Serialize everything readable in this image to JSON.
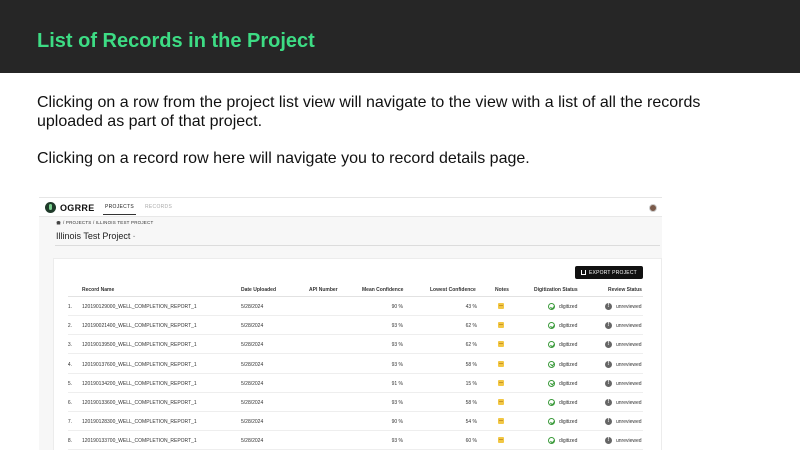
{
  "slide": {
    "title": "List of Records in the Project",
    "paragraph1": "Clicking on a row from the project list view will navigate to the view with a list of all the records uploaded as part of that project.",
    "paragraph2": "Clicking on a record row here will navigate you to record details page."
  },
  "app": {
    "brand": "OGRRE",
    "nav": {
      "projects": "PROJECTS",
      "records": "RECORDS"
    },
    "breadcrumb": "/ PROJECTS / ILLINOIS TEST PROJECT",
    "project_title": "Illinois Test Project",
    "export_label": "EXPORT PROJECT",
    "columns": {
      "record_name": "Record Name",
      "date_uploaded": "Date Uploaded",
      "api_number": "API Number",
      "mean_confidence": "Mean Confidence",
      "lowest_confidence": "Lowest Confidence",
      "notes": "Notes",
      "digitization_status": "Digitization Status",
      "review_status": "Review Status"
    },
    "rows": [
      {
        "idx": "1.",
        "name": "120190129000_WELL_COMPLETION_REPORT_1",
        "date": "5/28/2024",
        "api": "",
        "mean": "90 %",
        "low": "43 %",
        "dig": "digitized",
        "rev": "unreviewed"
      },
      {
        "idx": "2.",
        "name": "120190021400_WELL_COMPLETION_REPORT_1",
        "date": "5/28/2024",
        "api": "",
        "mean": "93 %",
        "low": "62 %",
        "dig": "digitized",
        "rev": "unreviewed"
      },
      {
        "idx": "3.",
        "name": "120190139500_WELL_COMPLETION_REPORT_1",
        "date": "5/28/2024",
        "api": "",
        "mean": "93 %",
        "low": "62 %",
        "dig": "digitized",
        "rev": "unreviewed"
      },
      {
        "idx": "4.",
        "name": "120190137600_WELL_COMPLETION_REPORT_1",
        "date": "5/28/2024",
        "api": "",
        "mean": "93 %",
        "low": "58 %",
        "dig": "digitized",
        "rev": "unreviewed"
      },
      {
        "idx": "5.",
        "name": "120190134200_WELL_COMPLETION_REPORT_1",
        "date": "5/28/2024",
        "api": "",
        "mean": "91 %",
        "low": "15 %",
        "dig": "digitized",
        "rev": "unreviewed"
      },
      {
        "idx": "6.",
        "name": "120190133600_WELL_COMPLETION_REPORT_1",
        "date": "5/28/2024",
        "api": "",
        "mean": "93 %",
        "low": "58 %",
        "dig": "digitized",
        "rev": "unreviewed"
      },
      {
        "idx": "7.",
        "name": "120190128300_WELL_COMPLETION_REPORT_1",
        "date": "5/28/2024",
        "api": "",
        "mean": "90 %",
        "low": "54 %",
        "dig": "digitized",
        "rev": "unreviewed"
      },
      {
        "idx": "8.",
        "name": "120190133700_WELL_COMPLETION_REPORT_1",
        "date": "5/28/2024",
        "api": "",
        "mean": "93 %",
        "low": "60 %",
        "dig": "digitized",
        "rev": "unreviewed"
      }
    ],
    "icons": {
      "logo": "ogrre-logo-icon",
      "home": "home-icon",
      "export": "export-icon",
      "note": "note-icon",
      "digitized": "check-circle-icon",
      "unreviewed": "alert-circle-icon"
    },
    "colors": {
      "title_accent": "#3ddc84",
      "title_bar_bg": "#262626",
      "digitized_green": "#3a9a3a",
      "note_yellow": "#f2c744"
    }
  }
}
